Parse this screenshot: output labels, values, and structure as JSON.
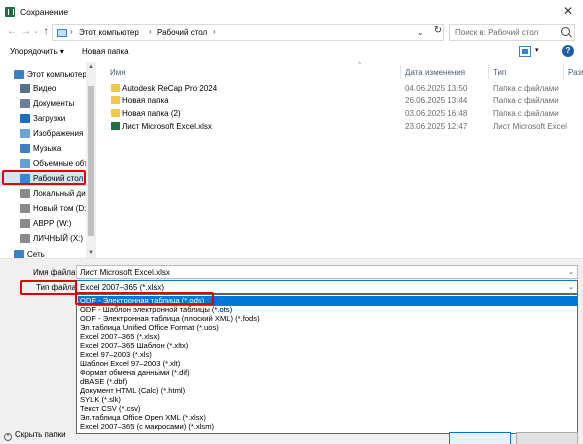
{
  "window": {
    "title": "Сохранение",
    "close_glyph": "✕"
  },
  "address": {
    "back_glyph": "←",
    "forward_glyph": "→",
    "recent_glyph": "⌄",
    "up_glyph": "↑",
    "crumb_sep": "›",
    "crumbs": [
      "Этот компьютер",
      "Рабочий стол"
    ],
    "dropdown_glyph": "⌄",
    "refresh_glyph": "↻",
    "search_placeholder": "Поиск в: Рабочий стол"
  },
  "toolbar": {
    "organize_label": "Упорядочить ▾",
    "new_folder_label": "Новая папка",
    "view_drop_glyph": "▾",
    "help_glyph": "?"
  },
  "nav": {
    "items": [
      {
        "label": "Этот компьютер",
        "icon": "computer-icon",
        "color": "#3b7fc4"
      },
      {
        "label": "Видео",
        "icon": "video-folder-icon",
        "color": "#5a6f8a"
      },
      {
        "label": "Документы",
        "icon": "documents-folder-icon",
        "color": "#6b7f99"
      },
      {
        "label": "Загрузки",
        "icon": "downloads-folder-icon",
        "color": "#1f6fbf"
      },
      {
        "label": "Изображения",
        "icon": "pictures-folder-icon",
        "color": "#6aa3d9"
      },
      {
        "label": "Музыка",
        "icon": "music-folder-icon",
        "color": "#3b7fc4"
      },
      {
        "label": "Объемные объ",
        "icon": "3d-objects-icon",
        "color": "#5fa0d8"
      },
      {
        "label": "Рабочий стол",
        "icon": "desktop-icon",
        "color": "#2d8ad8"
      },
      {
        "label": "Локальный дис",
        "icon": "local-disk-icon",
        "color": "#8a8a8a"
      },
      {
        "label": "Новый том (D:)",
        "icon": "drive-icon",
        "color": "#8a8a8a"
      },
      {
        "label": "ABPP (W:)",
        "icon": "network-drive-icon",
        "color": "#8a8a8a"
      },
      {
        "label": "ЛИЧНЫЙ (X:)",
        "icon": "network-drive-icon",
        "color": "#8a8a8a"
      },
      {
        "label": "Сеть",
        "icon": "network-icon",
        "color": "#3b7fc4"
      }
    ]
  },
  "filelist": {
    "sort_glyph": "^",
    "columns": [
      "Имя",
      "Дата изменения",
      "Тип",
      "Разм"
    ],
    "rows": [
      {
        "name": "Autodesk ReCap Pro 2024",
        "date": "04.06.2025 13:50",
        "type": "Папка с файлами",
        "icon": "folder-icon"
      },
      {
        "name": "Новая папка",
        "date": "26.06.2025 13:44",
        "type": "Папка с файлами",
        "icon": "folder-icon"
      },
      {
        "name": "Новая папка (2)",
        "date": "03.06.2025 16:48",
        "type": "Папка с файлами",
        "icon": "folder-icon"
      },
      {
        "name": "Лист Microsoft Excel.xlsx",
        "date": "23.06.2025 12:47",
        "type": "Лист Microsoft Excel",
        "icon": "excel-file-icon"
      }
    ]
  },
  "form": {
    "filename_label": "Имя файла:",
    "filename_value": "Лист Microsoft Excel.xlsx",
    "filetype_label": "Тип файла:",
    "filetype_value": "Excel 2007–365 (*.xlsx)",
    "dropdown_glyph": "⌄",
    "options": [
      "ODF - Электронная таблица (*.ods)",
      "ODF - Шаблон электронной таблицы (*.ots)",
      "ODF - Электронная таблица (плоский XML) (*.fods)",
      "Эл.таблица Unified Office Format (*.uos)",
      "Excel 2007–365 (*.xlsx)",
      "Excel 2007–365 Шаблон (*.xltx)",
      "Excel 97–2003 (*.xls)",
      "Шаблон Excel 97–2003 (*.xlt)",
      "Формат обмена данными (*.dif)",
      "dBASE (*.dbf)",
      "Документ HTML (Calc) (*.html)",
      "SYLK (*.slk)",
      "Текст CSV (*.csv)",
      "Эл.таблица Office Open XML (*.xlsx)",
      "Excel 2007–365 (с макросами) (*.xlsm)"
    ],
    "selected_index": 0,
    "hide_folders_glyph": "^",
    "hide_folders_label": "Скрыть папки"
  },
  "colors": {
    "accent": "#0078d7",
    "highlight": "#cce8ff",
    "annotation_red": "#e00000"
  }
}
